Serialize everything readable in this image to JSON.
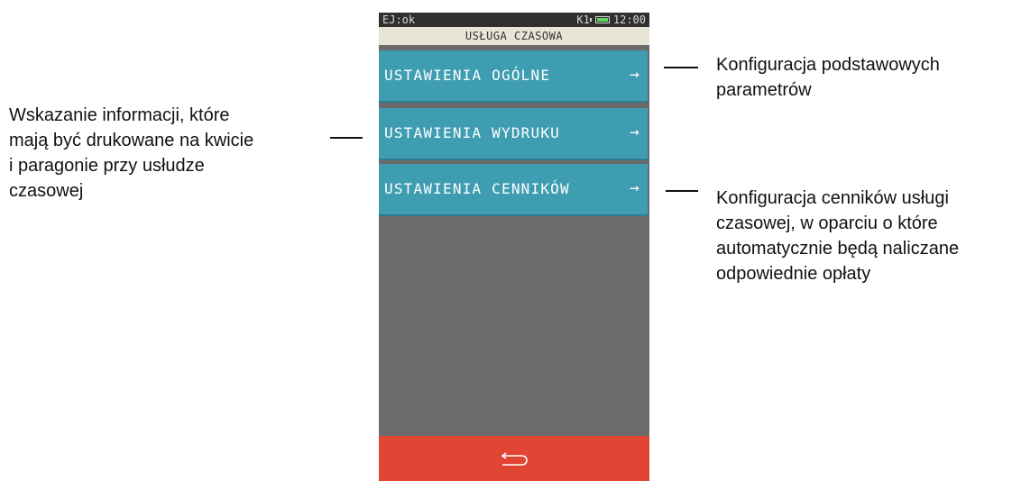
{
  "status_bar": {
    "left": "EJ:ok",
    "right": "K1",
    "time": "12:00"
  },
  "header": {
    "title": "USŁUGA CZASOWA"
  },
  "menu": [
    {
      "label": "USTAWIENIA OGÓLNE",
      "arrow": "→"
    },
    {
      "label": "USTAWIENIA WYDRUKU",
      "arrow": "→"
    },
    {
      "label": "USTAWIENIA CENNIKÓW",
      "arrow": "→"
    }
  ],
  "annotations": {
    "left": [
      "Wskazanie informacji, które",
      "mają być drukowane na kwicie",
      "i paragonie przy usłudze",
      "czasowej"
    ],
    "right_top": [
      "Konfiguracja podstawowych",
      "parametrów"
    ],
    "right_bottom": [
      "Konfiguracja cenników usługi",
      "czasowej, w oparciu o które",
      "automatycznie będą naliczane",
      "odpowiednie opłaty"
    ]
  },
  "icons": {
    "back": "back-arrow-icon",
    "battery": "battery-icon"
  },
  "colors": {
    "menu": "#3f9db1",
    "bottom": "#e04633",
    "body": "#6b6b6b",
    "header": "#e9e4d8"
  }
}
